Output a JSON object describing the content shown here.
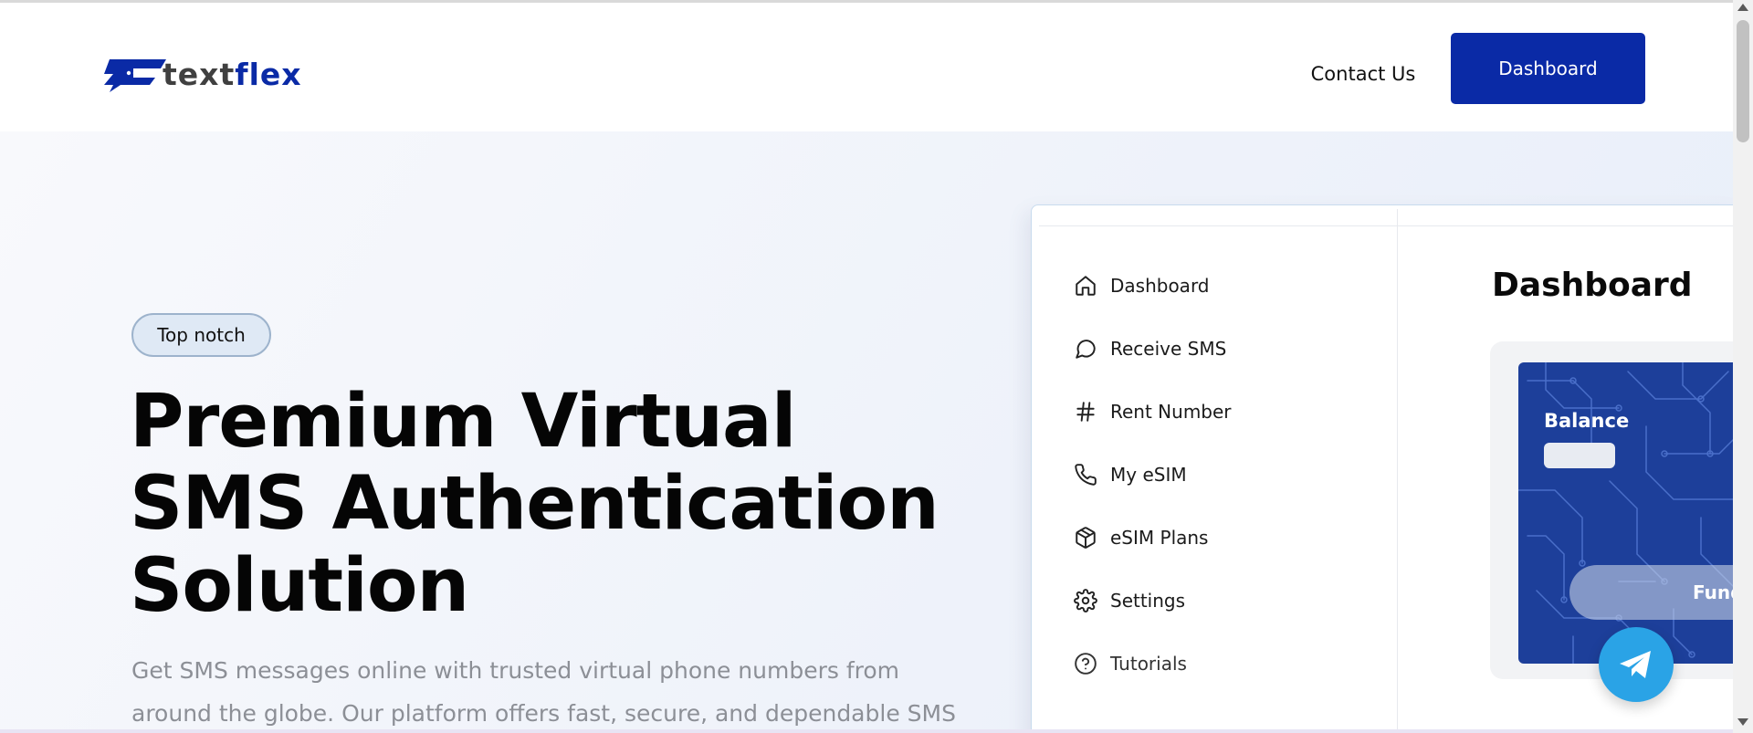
{
  "header": {
    "logo_text_part1": "text",
    "logo_text_part2": "flex",
    "contact_label": "Contact Us",
    "dashboard_button": "Dashboard"
  },
  "hero": {
    "badge": "Top notch",
    "headline_line1": "Premium Virtual",
    "headline_line2": "SMS Authentication",
    "headline_line3": "Solution",
    "subtext": "Get SMS messages online with trusted virtual phone numbers from around the globe. Our platform offers fast, secure, and dependable SMS"
  },
  "preview": {
    "nav": [
      {
        "label": "Dashboard",
        "icon": "home-icon"
      },
      {
        "label": "Receive SMS",
        "icon": "message-circle-icon"
      },
      {
        "label": "Rent Number",
        "icon": "hash-icon"
      },
      {
        "label": "My eSIM",
        "icon": "phone-icon"
      },
      {
        "label": "eSIM Plans",
        "icon": "package-icon"
      },
      {
        "label": "Settings",
        "icon": "gear-icon"
      },
      {
        "label": "Tutorials",
        "icon": "help-circle-icon"
      }
    ],
    "title": "Dashboard",
    "balance_label": "Balance",
    "fund_button": "Fund"
  },
  "colors": {
    "brand": "#0a2aa6",
    "telegram": "#2aa3e6",
    "card": "#1d3f9a"
  }
}
